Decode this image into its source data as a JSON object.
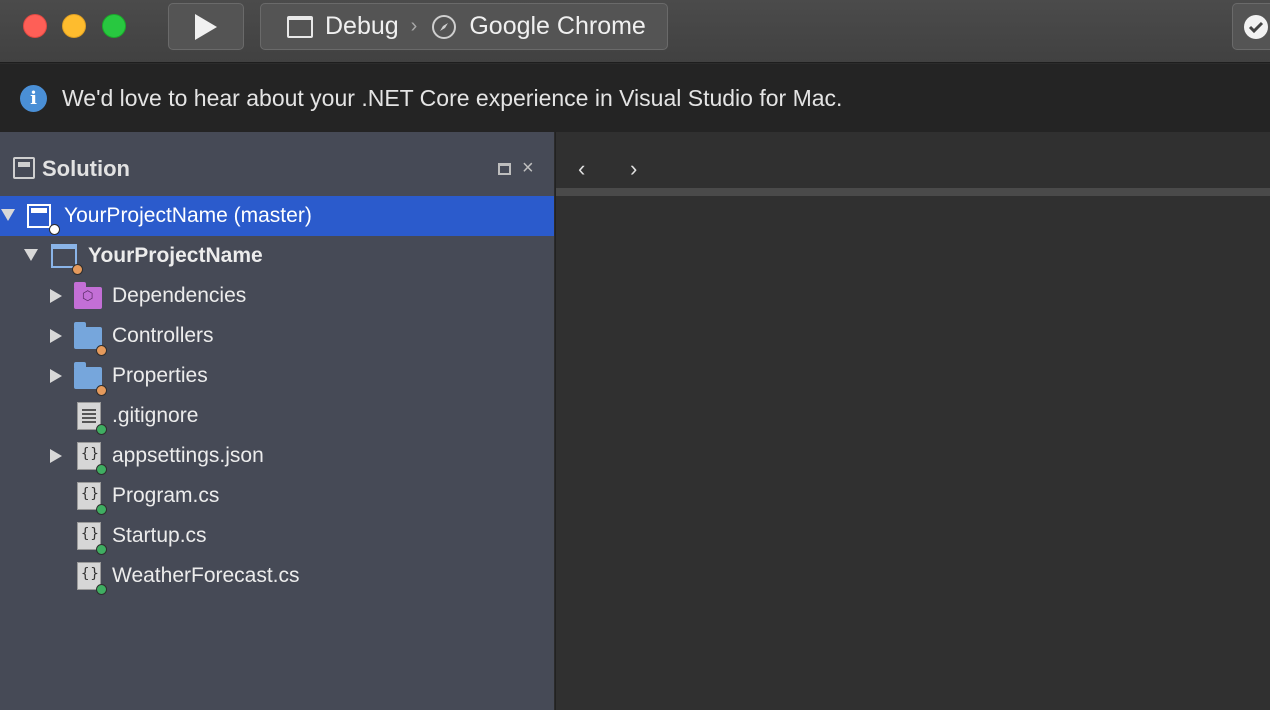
{
  "toolbar": {
    "configuration": "Debug",
    "separator": "›",
    "target": "Google Chrome"
  },
  "infobar": {
    "icon_glyph": "i",
    "message": "We'd love to hear about your .NET Core experience in Visual Studio for Mac."
  },
  "solution_pad": {
    "title": "Solution",
    "close_glyph": "×",
    "items": [
      {
        "label": "YourProjectName (master)"
      },
      {
        "label": "YourProjectName"
      },
      {
        "label": "Dependencies"
      },
      {
        "label": "Controllers"
      },
      {
        "label": "Properties"
      },
      {
        "label": ".gitignore"
      },
      {
        "label": "appsettings.json"
      },
      {
        "label": "Program.cs"
      },
      {
        "label": "Startup.cs"
      },
      {
        "label": "WeatherForecast.cs"
      }
    ]
  },
  "editor": {
    "back_glyph": "‹",
    "forward_glyph": "›"
  },
  "colors": {
    "selection": "#2b5bcc",
    "pad_background": "#464a56",
    "info_accent": "#4a8fd6"
  }
}
